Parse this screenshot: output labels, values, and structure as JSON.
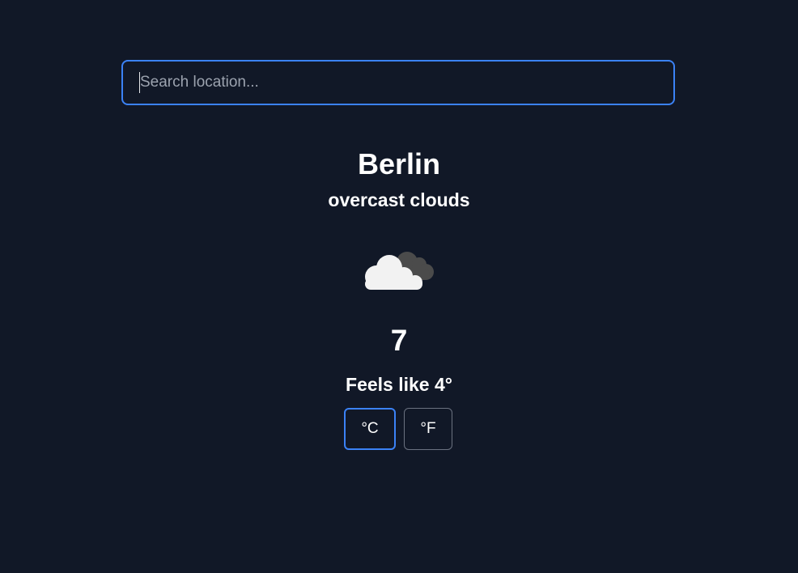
{
  "search": {
    "placeholder": "Search location...",
    "value": ""
  },
  "weather": {
    "city": "Berlin",
    "description": "overcast clouds",
    "icon": "overcast-clouds-icon",
    "temperature": "7",
    "feels_like": "Feels like 4°"
  },
  "units": {
    "celsius_label": "°C",
    "fahrenheit_label": "°F",
    "selected": "celsius"
  },
  "colors": {
    "background": "#111827",
    "accent": "#3b82f6",
    "text": "#ffffff",
    "muted_border": "#6b7280"
  }
}
